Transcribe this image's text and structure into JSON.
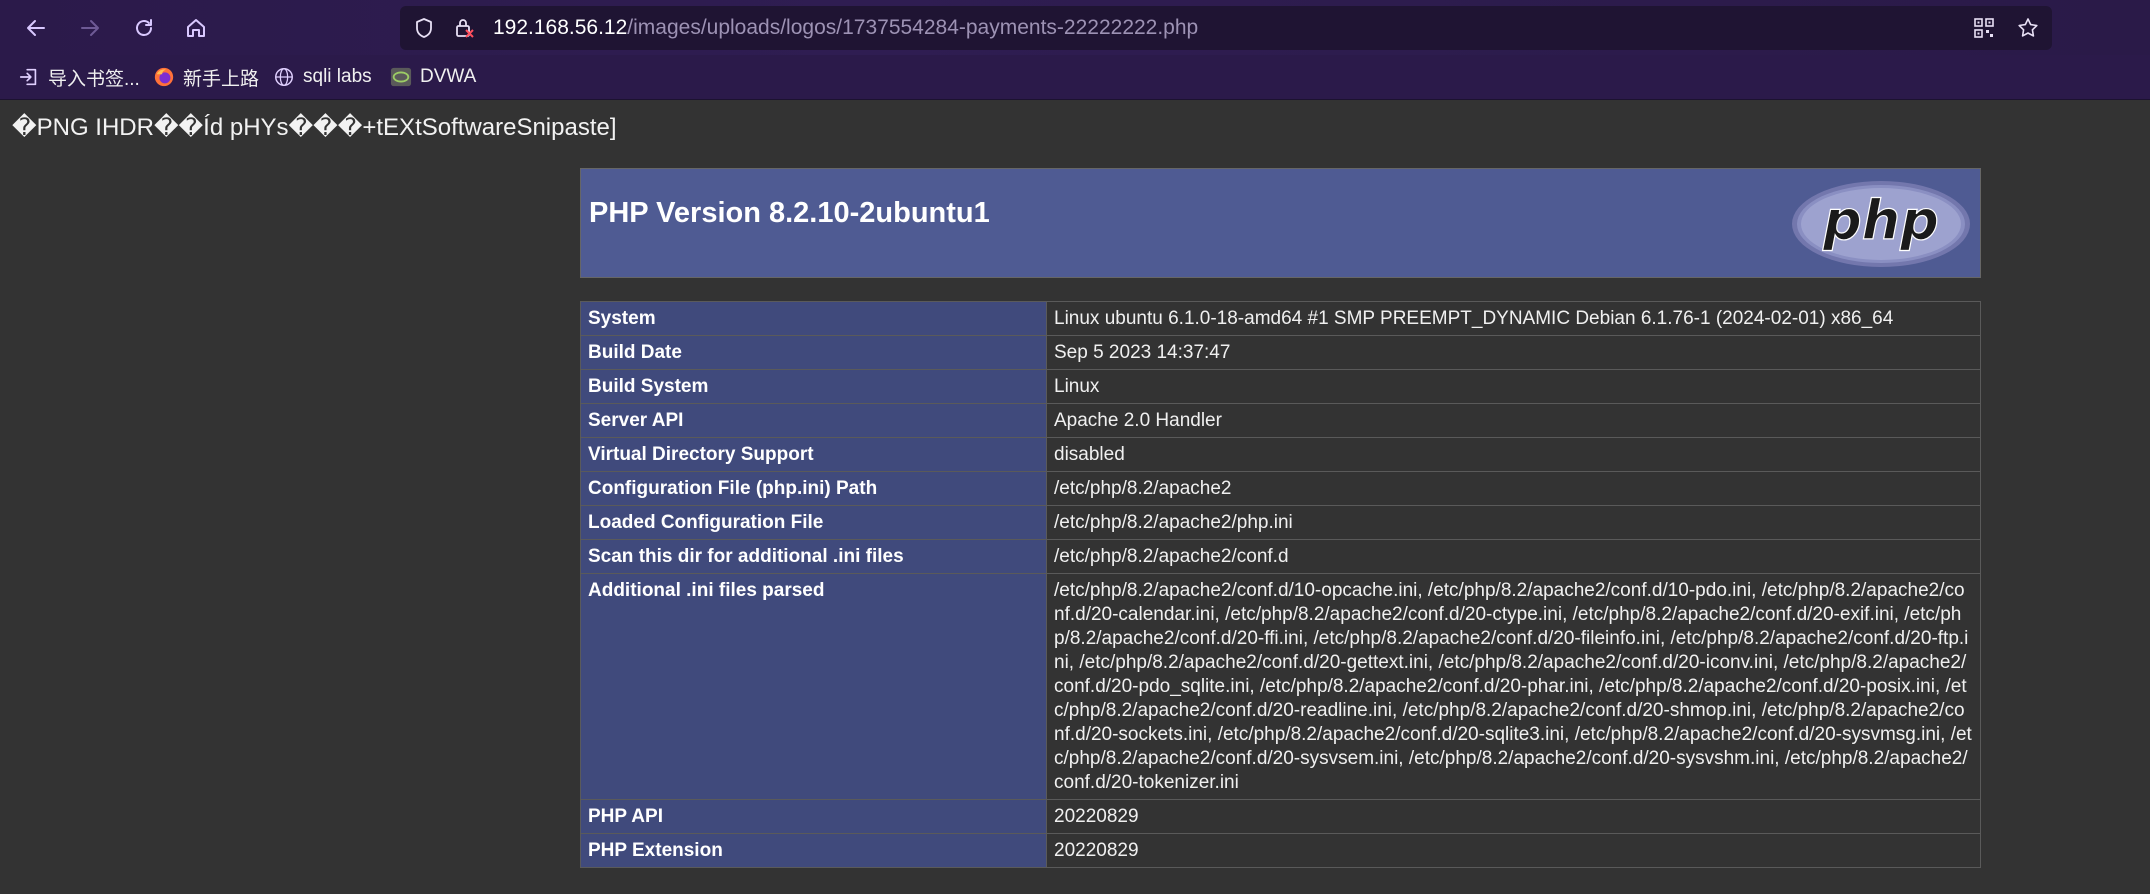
{
  "browser": {
    "url_host": "192.168.56.12",
    "url_path": "/images/uploads/logos/1737554284-payments-22222222.php",
    "bookmarks": [
      {
        "label": "导入书签...",
        "icon": "import-icon"
      },
      {
        "label": "新手上路",
        "icon": "firefox-icon"
      },
      {
        "label": "sqli labs",
        "icon": "globe-icon"
      },
      {
        "label": "DVWA",
        "icon": "dvwa-icon"
      }
    ]
  },
  "page": {
    "garbage_text": "�PNG  IHDR��Íd pHYs���+tEXtSoftwareSnipaste]",
    "php_header": "PHP Version 8.2.10-2ubuntu1",
    "rows": [
      {
        "key": "System",
        "value": "Linux ubuntu 6.1.0-18-amd64 #1 SMP PREEMPT_DYNAMIC Debian 6.1.76-1 (2024-02-01) x86_64"
      },
      {
        "key": "Build Date",
        "value": "Sep 5 2023 14:37:47"
      },
      {
        "key": "Build System",
        "value": "Linux"
      },
      {
        "key": "Server API",
        "value": "Apache 2.0 Handler"
      },
      {
        "key": "Virtual Directory Support",
        "value": "disabled"
      },
      {
        "key": "Configuration File (php.ini) Path",
        "value": "/etc/php/8.2/apache2"
      },
      {
        "key": "Loaded Configuration File",
        "value": "/etc/php/8.2/apache2/php.ini"
      },
      {
        "key": "Scan this dir for additional .ini files",
        "value": "/etc/php/8.2/apache2/conf.d"
      },
      {
        "key": "Additional .ini files parsed",
        "value": "/etc/php/8.2/apache2/conf.d/10-opcache.ini, /etc/php/8.2/apache2/conf.d/10-pdo.ini, /etc/php/8.2/apache2/conf.d/20-calendar.ini, /etc/php/8.2/apache2/conf.d/20-ctype.ini, /etc/php/8.2/apache2/conf.d/20-exif.ini, /etc/php/8.2/apache2/conf.d/20-ffi.ini, /etc/php/8.2/apache2/conf.d/20-fileinfo.ini, /etc/php/8.2/apache2/conf.d/20-ftp.ini, /etc/php/8.2/apache2/conf.d/20-gettext.ini, /etc/php/8.2/apache2/conf.d/20-iconv.ini, /etc/php/8.2/apache2/conf.d/20-pdo_sqlite.ini, /etc/php/8.2/apache2/conf.d/20-phar.ini, /etc/php/8.2/apache2/conf.d/20-posix.ini, /etc/php/8.2/apache2/conf.d/20-readline.ini, /etc/php/8.2/apache2/conf.d/20-shmop.ini, /etc/php/8.2/apache2/conf.d/20-sockets.ini, /etc/php/8.2/apache2/conf.d/20-sqlite3.ini, /etc/php/8.2/apache2/conf.d/20-sysvmsg.ini, /etc/php/8.2/apache2/conf.d/20-sysvsem.ini, /etc/php/8.2/apache2/conf.d/20-sysvshm.ini, /etc/php/8.2/apache2/conf.d/20-tokenizer.ini"
      },
      {
        "key": "PHP API",
        "value": "20220829"
      },
      {
        "key": "PHP Extension",
        "value": "20220829"
      }
    ]
  },
  "colors": {
    "chrome_bg": "#2b1a4a",
    "page_bg": "#333333",
    "header_bg": "#4f5b93",
    "key_cell_bg": "#404a7c",
    "accent_purple": "#c8a8ff"
  }
}
